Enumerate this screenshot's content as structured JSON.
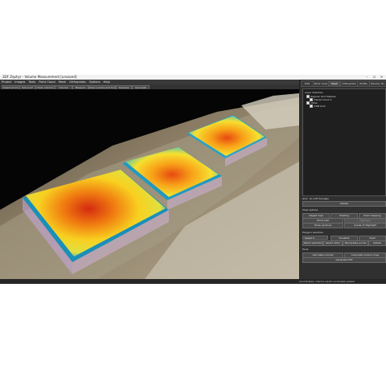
{
  "window": {
    "title": "3DF Zephyr - Volume Measurement [unsaved]",
    "controls": {
      "minimize": "–",
      "maximize": "☐",
      "close": "✕"
    }
  },
  "menu": [
    "Project",
    "Images",
    "Tools",
    "Point Cloud",
    "Mesh",
    "Orthophoto",
    "Options",
    "Help"
  ],
  "toolbar": [
    "Select point",
    "Set point",
    "Clear volume",
    "Volume",
    "Measure",
    "Save volume and boolean",
    "Samples",
    "Generate"
  ],
  "tabs": [
    "Edit",
    "Point cloud",
    "Mesh",
    "Orthophoto",
    "Profile",
    "Volume, flo..."
  ],
  "active_tab": "Mesh",
  "tree": {
    "title": "Layer Selection",
    "items": [
      {
        "label": "Regular Grid Meshes"
      },
      {
        "label": "Dense Cloud A"
      },
      {
        "label": "Other"
      },
      {
        "label": "DSM Grid"
      }
    ]
  },
  "panel": {
    "info": "Grid: 12.128 triangles",
    "delete_label": "Delete",
    "view_options_label": "View options",
    "row1": [
      "Height map",
      "Shading",
      "Point mapping"
    ],
    "row2": [
      "Show wall",
      "Highlight"
    ],
    "row3": [
      "Show sections",
      "Grade of Highlight"
    ],
    "polygon_selection_label": "Polygon selection",
    "mode_value": "Select",
    "row4_btns": [
      "Visualize",
      "Clear"
    ],
    "row5": [
      "Select selected",
      "Select other",
      "Manipulate points",
      "Delete"
    ],
    "tools_label": "Tools",
    "row6": [
      "Calculate volume",
      "Calculate contour lines"
    ],
    "generate_label": "Generate DXF"
  },
  "status": "Coordinates: volume result coordinate system"
}
